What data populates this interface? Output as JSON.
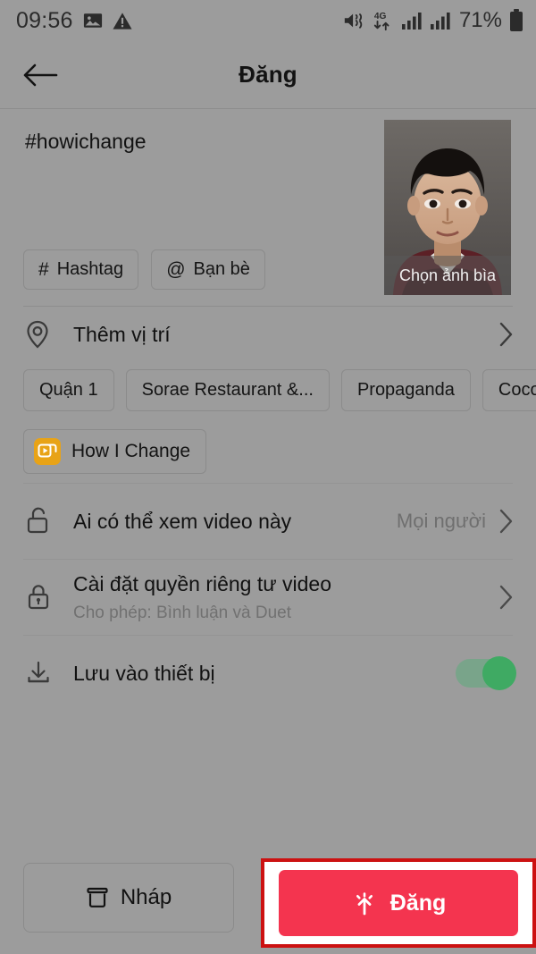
{
  "status_bar": {
    "time": "09:56",
    "battery_percent": "71%",
    "network_label": "4G",
    "icons": [
      "image-icon",
      "warning-icon",
      "mute-icon",
      "network-4g-icon",
      "signal-bars-icon",
      "signal-bars-icon-2",
      "battery-icon"
    ]
  },
  "header": {
    "title": "Đăng",
    "back_icon": "back-arrow-icon"
  },
  "caption": {
    "text": "#howichange",
    "hashtag_button": {
      "label": "Hashtag",
      "glyph": "#"
    },
    "mention_button": {
      "label": "Bạn bè",
      "glyph": "@"
    }
  },
  "cover": {
    "label": "Chọn ảnh bìa"
  },
  "location": {
    "label": "Thêm vị trí",
    "icon": "location-pin-icon",
    "chevron": "chevron-right-icon",
    "suggestions": [
      "Quận 1",
      "Sorae Restaurant &...",
      "Propaganda",
      "CocoDak -"
    ]
  },
  "effect": {
    "label": "How I Change",
    "badge_color": "#e8a317",
    "badge_icon": "effect-play-icon"
  },
  "privacy": {
    "visibility": {
      "label": "Ai có thể xem video này",
      "value": "Mọi người",
      "icon": "unlock-icon",
      "chevron": "chevron-right-icon"
    },
    "video_privacy": {
      "label": "Cài đặt quyền riêng tư video",
      "sub": "Cho phép: Bình luận và Duet",
      "icon": "lock-icon",
      "chevron": "chevron-right-icon"
    },
    "save_device": {
      "label": "Lưu vào thiết bị",
      "icon": "download-icon",
      "toggle_on": true,
      "toggle_color": "#3faa63"
    }
  },
  "bottom_bar": {
    "draft_label": "Nháp",
    "draft_icon": "draft-box-icon",
    "post_label": "Đăng",
    "post_icon": "post-burst-icon",
    "post_color": "#f4344f",
    "highlight_color": "#cc1111"
  }
}
